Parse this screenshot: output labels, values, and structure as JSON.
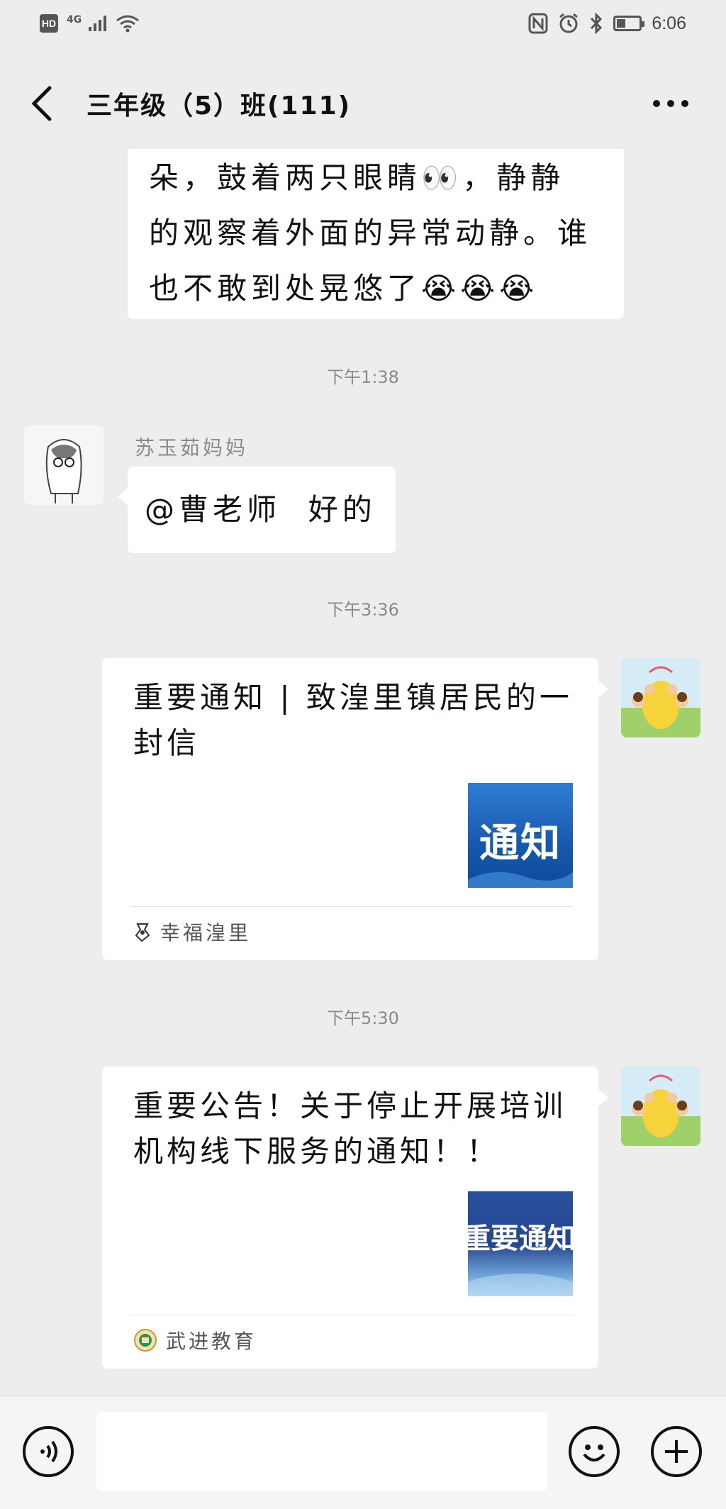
{
  "status": {
    "hd": "HD",
    "network": "4G",
    "time": "6:06",
    "battery_level": 0.3
  },
  "header": {
    "title": "三年级（5）班(111)",
    "back_icon": "chevron-left-icon",
    "more_icon": "more-dots-icon"
  },
  "messages": {
    "partial": {
      "lines": [
        "朵，鼓着两只眼睛👀，静静",
        "的观察着外面的异常动静。谁",
        "也不敢到处晃悠了😭😭😭"
      ]
    },
    "ts1": "下午1:38",
    "reply": {
      "sender": "苏玉茹妈妈",
      "text": "@曹老师  好的"
    },
    "ts2": "下午3:36",
    "card1": {
      "title": "重要通知 | 致湟里镇居民的一封信",
      "thumb_text": "通知",
      "source": "幸福湟里"
    },
    "ts3": "下午5:30",
    "card2": {
      "title": "重要公告！关于停止开展培训机构线下服务的通知！！",
      "thumb_text": "重要通知",
      "source": "武进教育"
    }
  },
  "input_bar": {
    "voice_icon": "voice-icon",
    "emoji_icon": "emoji-icon",
    "plus_icon": "plus-icon",
    "placeholder": ""
  }
}
